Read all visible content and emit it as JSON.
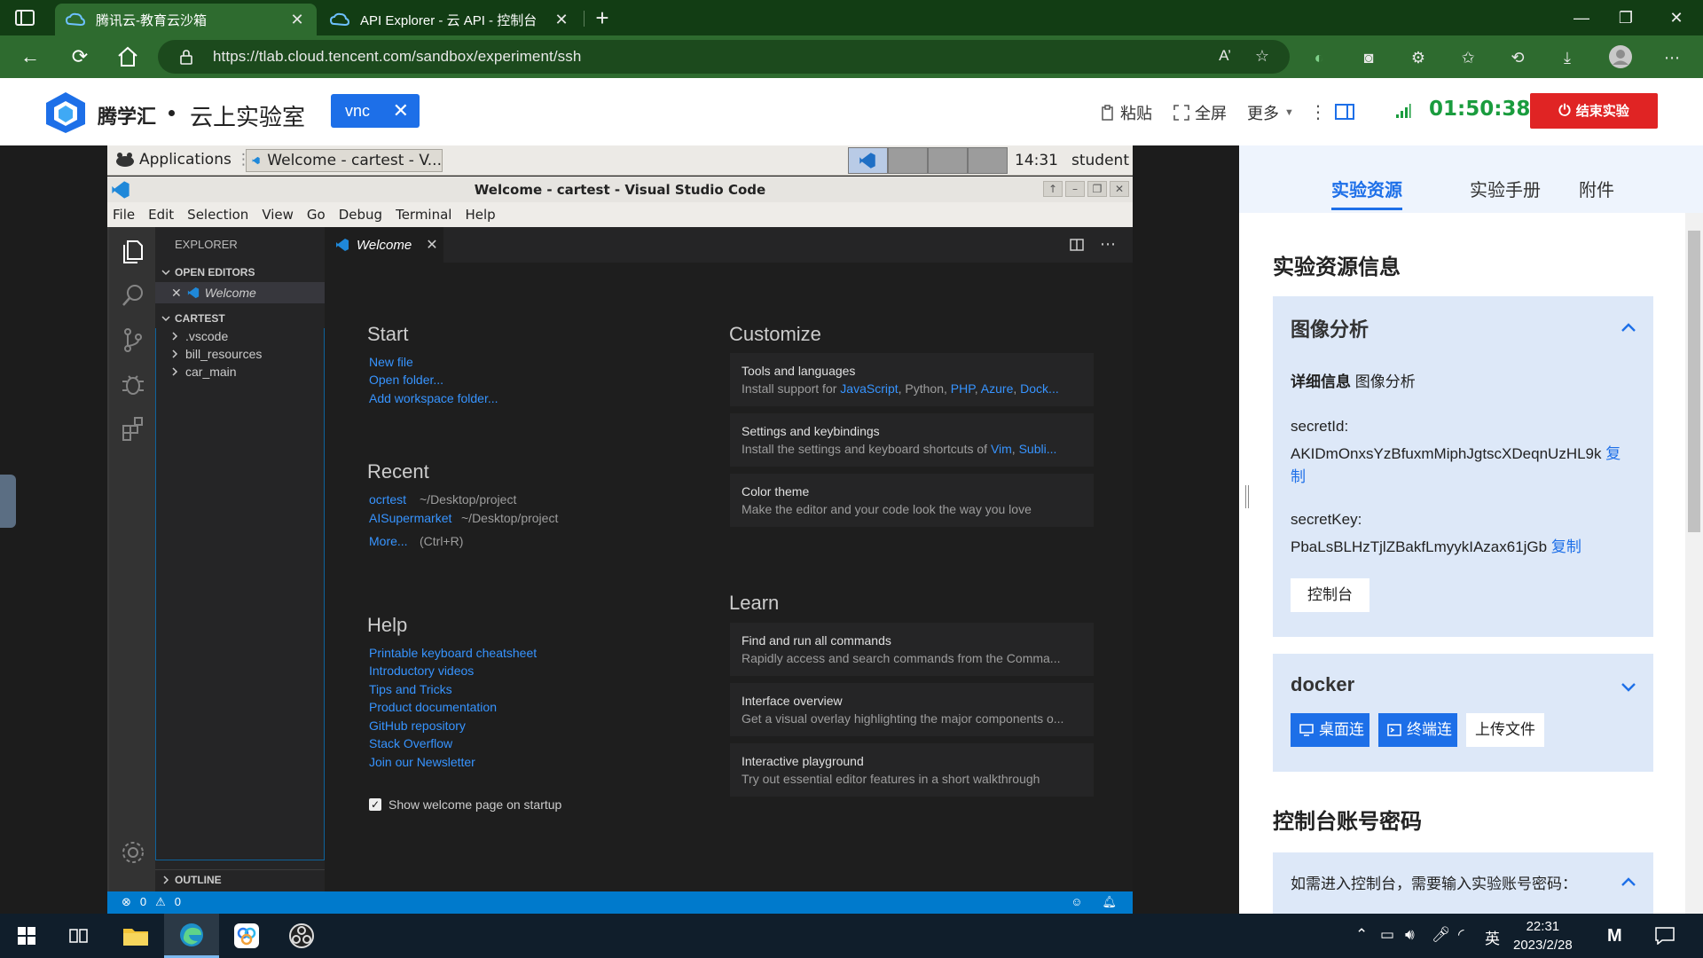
{
  "browser": {
    "tabs": [
      {
        "title": "腾讯云-教育云沙箱",
        "active": true
      },
      {
        "title": "API Explorer - 云 API - 控制台",
        "active": false
      }
    ],
    "url": "https://tlab.cloud.tencent.com/sandbox/experiment/ssh",
    "window_controls": [
      "—",
      "❐",
      "✕"
    ]
  },
  "site": {
    "brand": "腾学汇",
    "subtitle": "云上实验室",
    "vnc_tag": "vnc",
    "paste_label": "粘贴",
    "fullscreen_label": "全屏",
    "more_label": "更多",
    "timer": "01:50:38",
    "end_label": "结束实验",
    "colors": {
      "accent": "#1d6fe8",
      "timer": "#1a9c3e",
      "danger": "#e02424"
    }
  },
  "xfce": {
    "applications_label": "Applications",
    "task_label": "Welcome - cartest - V...",
    "clock": "14:31",
    "user": "student"
  },
  "vscode": {
    "window_title": "Welcome - cartest - Visual Studio Code",
    "menu": [
      "File",
      "Edit",
      "Selection",
      "View",
      "Go",
      "Debug",
      "Terminal",
      "Help"
    ],
    "explorer_header": "EXPLORER",
    "open_editors_label": "OPEN EDITORS",
    "open_editor_item": "Welcome",
    "folder_label": "CARTEST",
    "tree": [
      ".vscode",
      "bill_resources",
      "car_main"
    ],
    "outline_label": "OUTLINE",
    "tab_label": "Welcome",
    "welcome": {
      "start_heading": "Start",
      "start_links": [
        "New file",
        "Open folder...",
        "Add workspace folder..."
      ],
      "recent_heading": "Recent",
      "recent": [
        {
          "name": "ocrtest",
          "path": "~/Desktop/project"
        },
        {
          "name": "AISupermarket",
          "path": "~/Desktop/project"
        }
      ],
      "more_label": "More...",
      "more_hint": "(Ctrl+R)",
      "help_heading": "Help",
      "help_links": [
        "Printable keyboard cheatsheet",
        "Introductory videos",
        "Tips and Tricks",
        "Product documentation",
        "GitHub repository",
        "Stack Overflow",
        "Join our Newsletter"
      ],
      "startup_label": "Show welcome page on startup",
      "startup_checked": true,
      "customize_heading": "Customize",
      "customize_cards": [
        {
          "title": "Tools and languages",
          "desc_prefix": "Install support for ",
          "links": [
            "JavaScript",
            "Python",
            "PHP",
            "Azure",
            "Dock..."
          ]
        },
        {
          "title": "Settings and keybindings",
          "desc_prefix": "Install the settings and keyboard shortcuts of ",
          "links": [
            "Vim",
            "Subli..."
          ]
        },
        {
          "title": "Color theme",
          "desc": "Make the editor and your code look the way you love"
        }
      ],
      "learn_heading": "Learn",
      "learn_cards": [
        {
          "title": "Find and run all commands",
          "desc": "Rapidly access and search commands from the Comma..."
        },
        {
          "title": "Interface overview",
          "desc": "Get a visual overlay highlighting the major components o..."
        },
        {
          "title": "Interactive playground",
          "desc": "Try out essential editor features in a short walkthrough"
        }
      ]
    },
    "status": {
      "errors": "0",
      "warnings": "0"
    }
  },
  "panel": {
    "tabs": [
      "实验资源",
      "实验手册",
      "附件"
    ],
    "section_title": "实验资源信息",
    "image_card": {
      "title": "图像分析",
      "detail_label": "详细信息",
      "detail_value": "图像分析",
      "secret_id_label": "secretId:",
      "secret_id_value": "AKIDmOnxsYzBfuxmMiphJgtscXDeqnUzHL9k",
      "secret_key_label": "secretKey:",
      "secret_key_value": "PbaLsBLHzTjlZBakfLmyykIAzax61jGb",
      "copy_label_1": "复",
      "copy_label_2": "制",
      "copy_label": "复制",
      "console_button": "控制台"
    },
    "docker_card": {
      "title": "docker",
      "desktop_button": "桌面连",
      "terminal_button": "终端连",
      "upload_button": "上传文件"
    },
    "account_title": "控制台账号密码",
    "account_hint": "如需进入控制台，需要输入实验账号密码："
  },
  "taskbar": {
    "ime": "英",
    "time": "22:31",
    "date": "2023/2/28"
  }
}
